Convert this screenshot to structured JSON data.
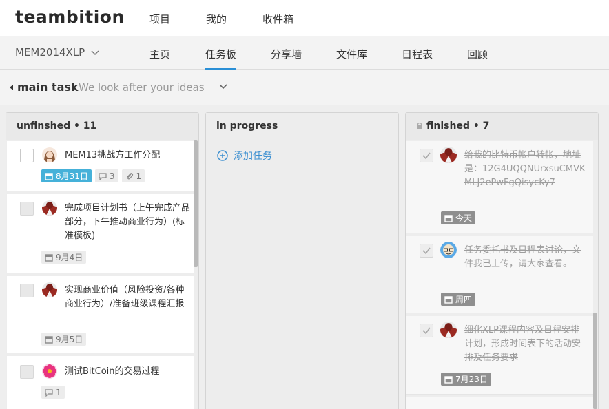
{
  "topbar": {
    "logo": "teambition",
    "nav": [
      "项目",
      "我的",
      "收件箱"
    ]
  },
  "project": {
    "name": "MEM2014XLP",
    "tabs": [
      "主页",
      "任务板",
      "分享墙",
      "文件库",
      "日程表",
      "回顾"
    ],
    "active_tab": "任务板"
  },
  "stage": {
    "title": "main task",
    "subtitle": "We look after your ideas"
  },
  "columns": {
    "unfinished": {
      "title": "unfinshed • 11",
      "cards": [
        {
          "text": "MEM13挑战方工作分配",
          "due": "8月31日",
          "comments": "3",
          "attachments": "1"
        },
        {
          "text": "完成项目计划书（上午完成产品部分，下午推动商业行为）(标准模板)",
          "due": "9月4日"
        },
        {
          "text": "实现商业价值（风险投资/各种商业行为）/准备班级课程汇报",
          "due": "9月5日"
        },
        {
          "text": "测试BitCoin的交易过程",
          "comments": "1"
        }
      ]
    },
    "in_progress": {
      "title": "in progress",
      "add_task": "添加任务"
    },
    "finished": {
      "title": "finished • 7",
      "cards": [
        {
          "text": "给我的比特币帐户转帐，地址是：12G4UQQNUrxsuCMVKMLJ2ePwFgQisycKy7",
          "due": "今天"
        },
        {
          "text": "任务委托书及日程表讨论，文件我已上传，请大家查看。",
          "due": "周四"
        },
        {
          "text": "细化XLP课程内容及日程安排计划，形成时间表下的活动安排及任务要求",
          "due": "7月23日"
        }
      ]
    }
  },
  "colors": {
    "accent": "#2a8fd6",
    "due_today": "#45b1d9",
    "due_past": "#8f8f8f"
  }
}
